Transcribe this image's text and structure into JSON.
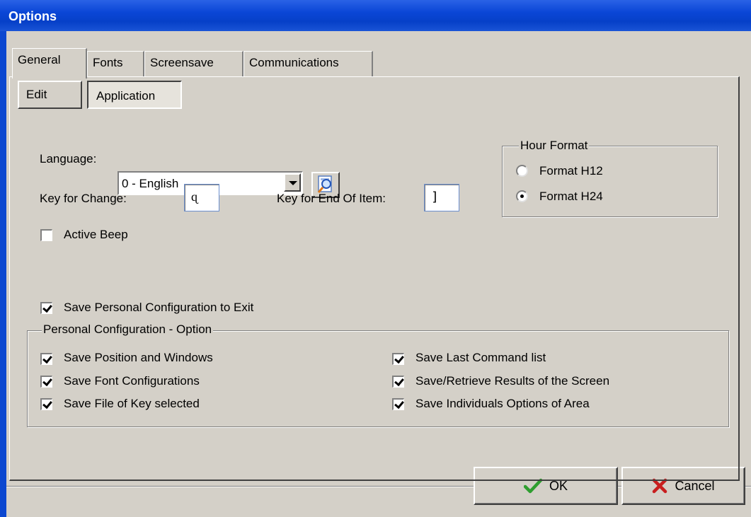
{
  "window": {
    "title": "Options"
  },
  "tabs": [
    "General",
    "Fonts",
    "Screensave",
    "Communications"
  ],
  "subtabs": {
    "edit": "Edit",
    "application": "Application"
  },
  "language": {
    "label": "Language:",
    "value": "0 - English"
  },
  "key_change": {
    "label": "Key for Change:",
    "value": "ɋ"
  },
  "key_end": {
    "label": "Key for End Of Item:",
    "value": "]"
  },
  "active_beep": {
    "label": "Active Beep",
    "checked": false
  },
  "hour_format": {
    "title": "Hour Format",
    "options": [
      "Format H12",
      "Format H24"
    ],
    "selected": "Format H24"
  },
  "save_personal": {
    "label": "Save Personal Configuration to Exit",
    "checked": true
  },
  "personal_options": {
    "title": "Personal Configuration - Option",
    "items": [
      "Save Position and Windows",
      "Save Font Configurations",
      "Save File of Key selected",
      "Save Last Command list",
      "Save/Retrieve Results of the Screen",
      "Save Individuals Options of Area"
    ]
  },
  "buttons": {
    "ok": "OK",
    "cancel": "Cancel"
  },
  "colors": {
    "titlebar": "#0a46d6",
    "face": "#d4d0c8",
    "ok_check": "#2f9e2f",
    "cancel_x": "#c81e1e"
  },
  "icons": {
    "lookup": "magnifier-icon",
    "ok": "checkmark-icon",
    "cancel": "x-icon"
  }
}
